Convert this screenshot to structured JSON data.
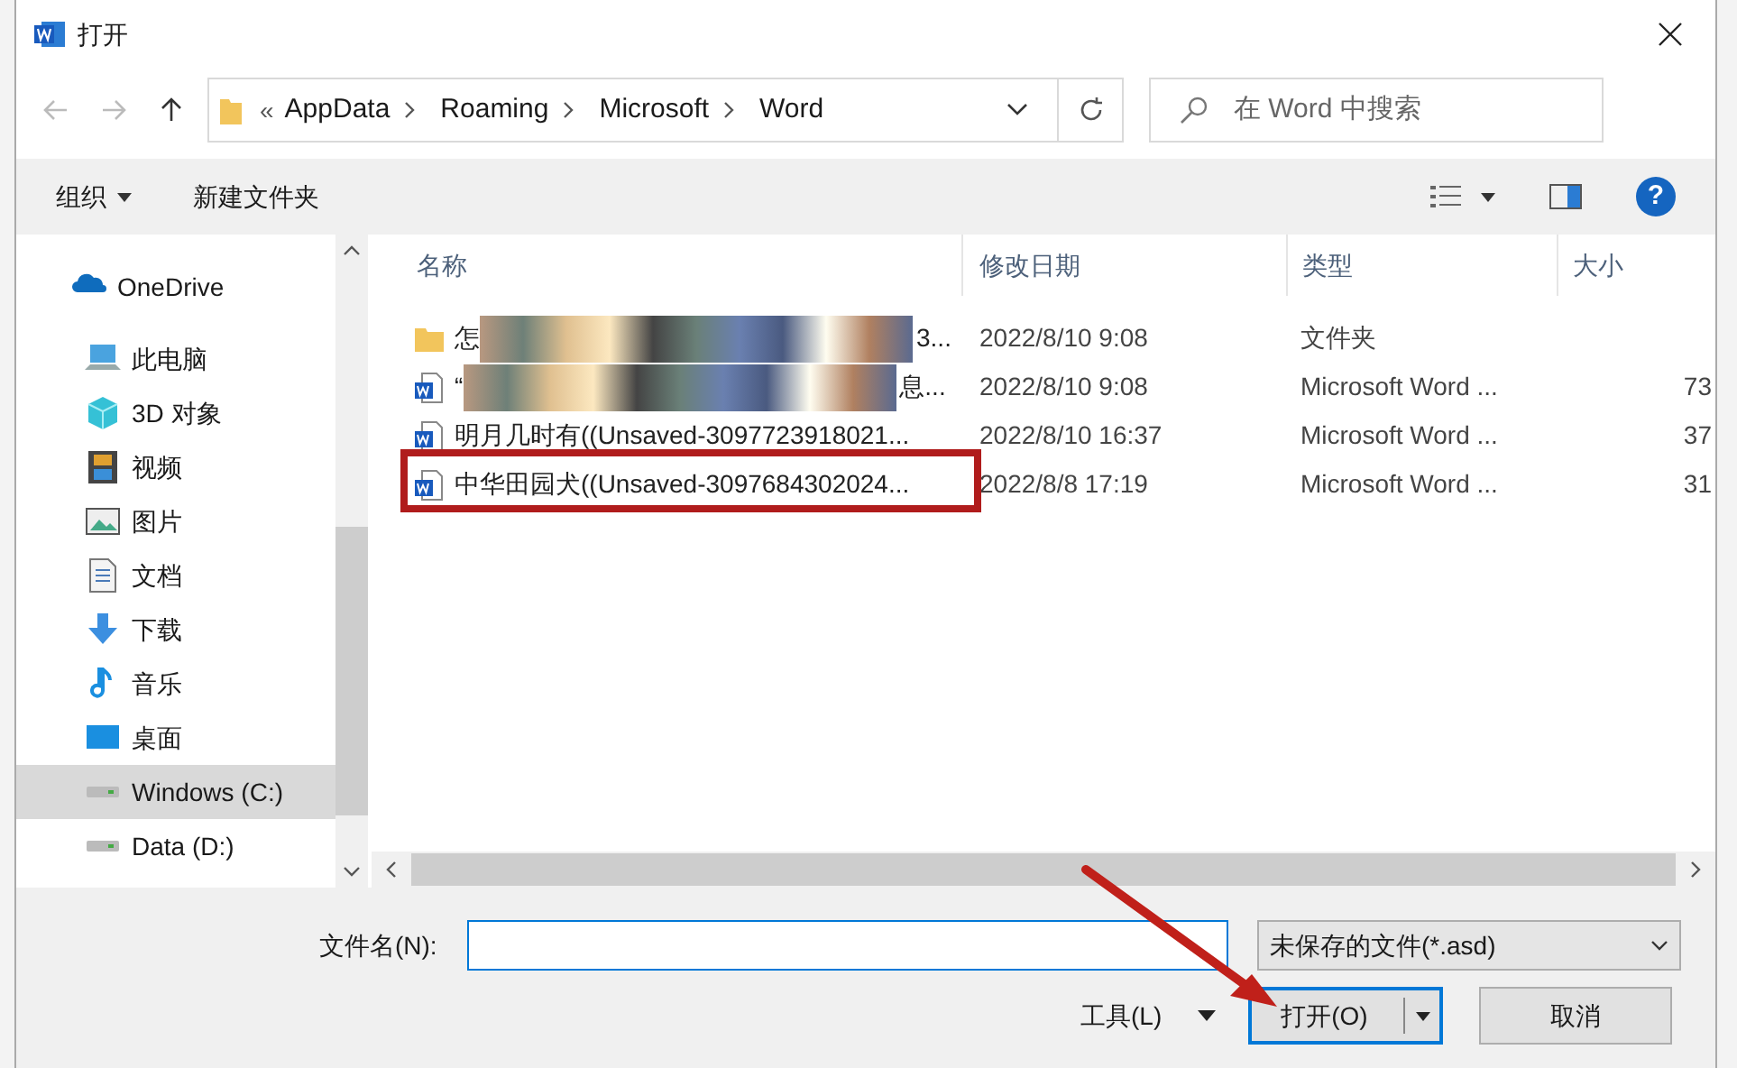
{
  "window": {
    "title": "打开"
  },
  "breadcrumb": {
    "prefix": "«",
    "parts": [
      "AppData",
      "Roaming",
      "Microsoft",
      "Word"
    ]
  },
  "search": {
    "placeholder": "在 Word 中搜索"
  },
  "toolbar": {
    "organize": "组织",
    "new_folder": "新建文件夹",
    "help": "?"
  },
  "sidebar": {
    "items": [
      {
        "label": "OneDrive",
        "kind": "cloud",
        "selected": false
      },
      {
        "label": "此电脑",
        "kind": "computer",
        "selected": false
      },
      {
        "label": "3D 对象",
        "kind": "cube",
        "selected": false
      },
      {
        "label": "视频",
        "kind": "film",
        "selected": false
      },
      {
        "label": "图片",
        "kind": "picture",
        "selected": false
      },
      {
        "label": "文档",
        "kind": "document",
        "selected": false
      },
      {
        "label": "下载",
        "kind": "download",
        "selected": false
      },
      {
        "label": "音乐",
        "kind": "music",
        "selected": false
      },
      {
        "label": "桌面",
        "kind": "desktop",
        "selected": false
      },
      {
        "label": "Windows (C:)",
        "kind": "drive",
        "selected": true
      },
      {
        "label": "Data (D:)",
        "kind": "drive",
        "selected": false
      }
    ]
  },
  "table": {
    "columns": [
      "名称",
      "修改日期",
      "类型",
      "大小"
    ],
    "rows": [
      {
        "kind": "folder",
        "name": "怎",
        "name_end": "3...",
        "redacted": true,
        "date": "2022/8/10 9:08",
        "type": "文件夹",
        "highlighted": false
      },
      {
        "kind": "word",
        "name": "“",
        "name_end": "息...",
        "redacted": true,
        "date": "2022/8/10 9:08",
        "type": "Microsoft Word ...",
        "size": "73",
        "highlighted": false
      },
      {
        "kind": "word",
        "name": "明月几时有((Unsaved-3097723918021...",
        "redacted": false,
        "date": "2022/8/10 16:37",
        "type": "Microsoft Word ...",
        "size": "37",
        "highlighted": false
      },
      {
        "kind": "word",
        "name": "中华田园犬((Unsaved-3097684302024...",
        "redacted": false,
        "date": "2022/8/8 17:19",
        "type": "Microsoft Word ...",
        "size": "31",
        "highlighted": true
      }
    ]
  },
  "filename": {
    "label": "文件名(N):"
  },
  "filetype": {
    "value": "未保存的文件(*.asd)"
  },
  "buttons": {
    "tools": "工具(L)",
    "open": "打开(O)",
    "cancel": "取消"
  }
}
